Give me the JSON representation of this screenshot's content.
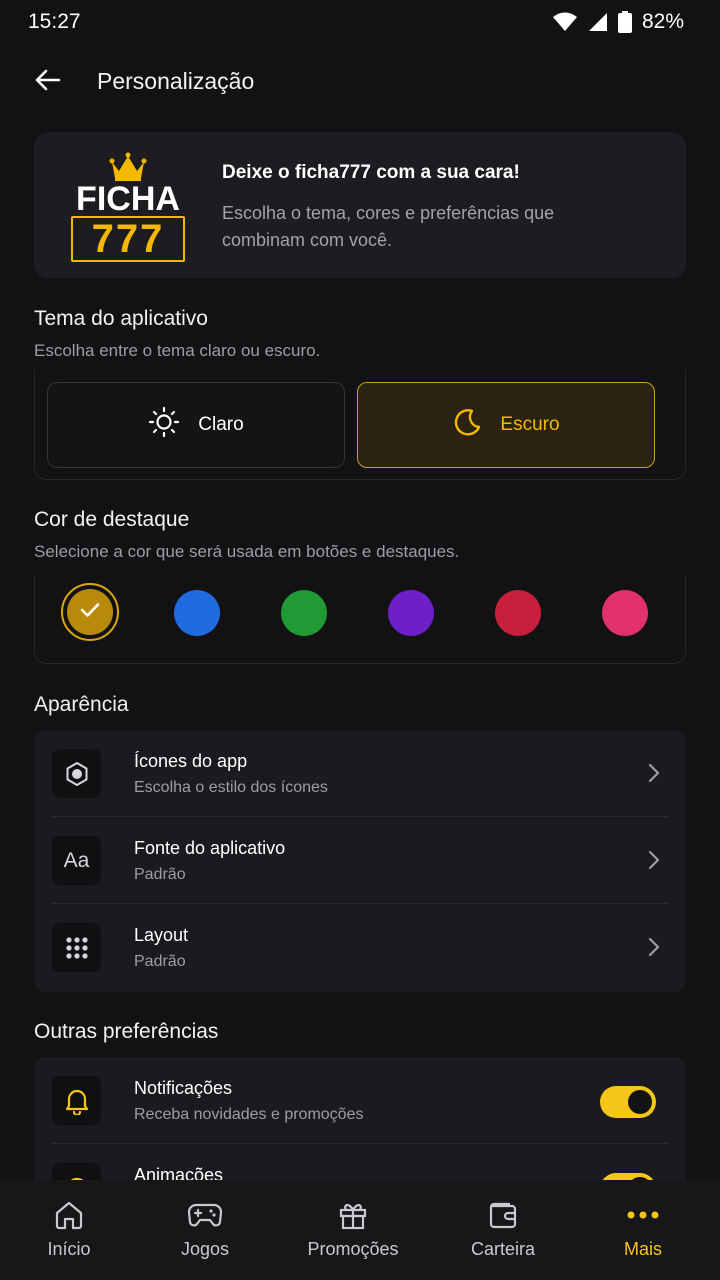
{
  "status_bar": {
    "time": "15:27",
    "battery": "82%"
  },
  "header": {
    "title": "Personalização"
  },
  "promo": {
    "logo_text_top": "FICHA",
    "logo_text_bottom": "777",
    "title": "Deixe o ficha777 com a sua cara!",
    "subtitle": "Escolha o tema, cores e preferências que combinam com você."
  },
  "theme": {
    "title": "Tema do aplicativo",
    "description": "Escolha entre o tema claro ou escuro.",
    "options": [
      {
        "label": "Claro",
        "icon": "sun-icon"
      },
      {
        "label": "Escuro",
        "icon": "moon-icon",
        "selected": true
      }
    ]
  },
  "accent": {
    "title": "Cor de destaque",
    "description": "Selecione a cor que será usada em botões e destaques.",
    "colors": [
      "#b88a0a",
      "#1f6ce0",
      "#1f9a34",
      "#6e1fc9",
      "#c8203c",
      "#e0306e"
    ],
    "selected_index": 0
  },
  "appearance": {
    "title": "Aparência",
    "items": [
      {
        "title": "Ícones do app",
        "subtitle": "Escolha o estilo dos ícones",
        "icon": "app-icon-icon"
      },
      {
        "title": "Fonte do aplicativo",
        "subtitle": "Padrão",
        "icon": "font-icon",
        "icon_text": "Aa"
      },
      {
        "title": "Layout",
        "subtitle": "Padrão",
        "icon": "grid-icon"
      }
    ]
  },
  "other": {
    "title": "Outras preferências",
    "items": [
      {
        "title": "Notificações",
        "subtitle": "Receba novidades e promoções",
        "icon": "bell-icon",
        "enabled": true
      },
      {
        "title": "Animações",
        "subtitle": "",
        "icon": "sparkle-icon",
        "enabled": true
      }
    ]
  },
  "nav": {
    "items": [
      {
        "label": "Início",
        "icon": "home-icon"
      },
      {
        "label": "Jogos",
        "icon": "gamepad-icon"
      },
      {
        "label": "Promoções",
        "icon": "gift-icon"
      },
      {
        "label": "Carteira",
        "icon": "wallet-icon"
      },
      {
        "label": "Mais",
        "icon": "more-icon",
        "active": true
      }
    ]
  },
  "colors": {
    "accent": "#f5c518",
    "background": "#121214",
    "card": "#1b1b1f"
  }
}
